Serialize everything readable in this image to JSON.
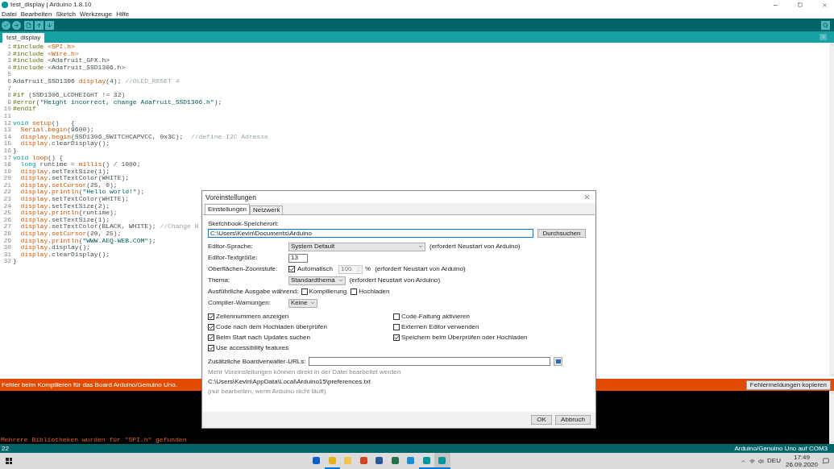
{
  "window": {
    "title": "test_display | Arduino 1.8.10"
  },
  "menu": [
    "Datei",
    "Bearbeiten",
    "Sketch",
    "Werkzeuge",
    "Hilfe"
  ],
  "tabs": [
    {
      "label": "test_display",
      "selected": true
    }
  ],
  "code": [
    {
      "n": "1",
      "tokens": [
        {
          "kind": "dir",
          "t": "#include "
        },
        {
          "kind": "fn",
          "t": "<SPI.h>"
        }
      ]
    },
    {
      "n": "2",
      "tokens": [
        {
          "kind": "dir",
          "t": "#include "
        },
        {
          "kind": "fn",
          "t": "<Wire.h>"
        }
      ]
    },
    {
      "n": "3",
      "tokens": [
        {
          "kind": "dir",
          "t": "#include"
        },
        {
          "kind": "p",
          "t": " <Adafruit_GFX.h>"
        }
      ]
    },
    {
      "n": "4",
      "tokens": [
        {
          "kind": "dir",
          "t": "#include"
        },
        {
          "kind": "p",
          "t": " <Adafruit_SSD1306.h>"
        }
      ]
    },
    {
      "n": "5"
    },
    {
      "n": "6",
      "tokens": [
        {
          "kind": "p",
          "t": "Adafruit_SSD1306 "
        },
        {
          "kind": "fn",
          "t": "display"
        },
        {
          "kind": "p",
          "t": "(4); "
        },
        {
          "kind": "cm",
          "t": "//OLED_RESET 4"
        }
      ]
    },
    {
      "n": "7"
    },
    {
      "n": "8",
      "tokens": [
        {
          "kind": "dir",
          "t": "#if"
        },
        {
          "kind": "p",
          "t": " (SSD1306_LCDHEIGHT != 32)"
        }
      ]
    },
    {
      "n": "9",
      "tokens": [
        {
          "kind": "dir",
          "t": "#error"
        },
        {
          "kind": "p",
          "t": "("
        },
        {
          "kind": "str",
          "t": "\"Height incorrect, change Adafruit_SSD1306.h\""
        },
        {
          "kind": "p",
          "t": ");"
        }
      ]
    },
    {
      "n": "10",
      "tokens": [
        {
          "kind": "dir",
          "t": "#endif"
        }
      ]
    },
    {
      "n": "11"
    },
    {
      "n": "12",
      "tokens": [
        {
          "kind": "kw",
          "t": "void "
        },
        {
          "kind": "fn",
          "t": "setup"
        },
        {
          "kind": "p",
          "t": "()   {"
        }
      ]
    },
    {
      "n": "13",
      "tokens": [
        {
          "kind": "fn",
          "t": "  Serial"
        },
        {
          "kind": "p",
          "t": "."
        },
        {
          "kind": "fn",
          "t": "begin"
        },
        {
          "kind": "p",
          "t": "(9600);"
        }
      ]
    },
    {
      "n": "14",
      "tokens": [
        {
          "kind": "fn",
          "t": "  display"
        },
        {
          "kind": "p",
          "t": "."
        },
        {
          "kind": "fn",
          "t": "begin"
        },
        {
          "kind": "p",
          "t": "(SSD1306_SWITCHCAPVCC, 0x3C);  "
        },
        {
          "kind": "cm",
          "t": "//define I2C Adresse"
        }
      ]
    },
    {
      "n": "15",
      "tokens": [
        {
          "kind": "fn",
          "t": "  display"
        },
        {
          "kind": "p",
          "t": ".clearDisplay();"
        }
      ]
    },
    {
      "n": "16",
      "tokens": [
        {
          "kind": "p",
          "t": "}"
        }
      ]
    },
    {
      "n": "17",
      "tokens": [
        {
          "kind": "kw",
          "t": "void "
        },
        {
          "kind": "fn",
          "t": "loop"
        },
        {
          "kind": "p",
          "t": "() {"
        }
      ]
    },
    {
      "n": "18",
      "tokens": [
        {
          "kind": "kw",
          "t": "  long"
        },
        {
          "kind": "p",
          "t": " runtime = "
        },
        {
          "kind": "fn",
          "t": "millis"
        },
        {
          "kind": "p",
          "t": "() / 1000;"
        }
      ]
    },
    {
      "n": "19",
      "tokens": [
        {
          "kind": "fn",
          "t": "  display"
        },
        {
          "kind": "p",
          "t": ".setTextSize(1);"
        }
      ]
    },
    {
      "n": "20",
      "tokens": [
        {
          "kind": "fn",
          "t": "  display"
        },
        {
          "kind": "p",
          "t": ".setTextColor(WHITE);"
        }
      ]
    },
    {
      "n": "21",
      "tokens": [
        {
          "kind": "fn",
          "t": "  display"
        },
        {
          "kind": "p",
          "t": "."
        },
        {
          "kind": "fn",
          "t": "setCursor"
        },
        {
          "kind": "p",
          "t": "(25, 0);"
        }
      ]
    },
    {
      "n": "22",
      "tokens": [
        {
          "kind": "fn",
          "t": "  display"
        },
        {
          "kind": "p",
          "t": "."
        },
        {
          "kind": "fn",
          "t": "println"
        },
        {
          "kind": "p",
          "t": "("
        },
        {
          "kind": "str",
          "t": "\"Hello world!\""
        },
        {
          "kind": "p",
          "t": ");"
        }
      ]
    },
    {
      "n": "23",
      "tokens": [
        {
          "kind": "fn",
          "t": "  display"
        },
        {
          "kind": "p",
          "t": ".setTextColor(WHITE);"
        }
      ]
    },
    {
      "n": "24",
      "tokens": [
        {
          "kind": "fn",
          "t": "  display"
        },
        {
          "kind": "p",
          "t": ".setTextSize(2);"
        }
      ]
    },
    {
      "n": "25",
      "tokens": [
        {
          "kind": "fn",
          "t": "  display"
        },
        {
          "kind": "p",
          "t": "."
        },
        {
          "kind": "fn",
          "t": "println"
        },
        {
          "kind": "p",
          "t": "(runtime);"
        }
      ]
    },
    {
      "n": "26",
      "tokens": [
        {
          "kind": "fn",
          "t": "  display"
        },
        {
          "kind": "p",
          "t": ".setTextSize(1);"
        }
      ]
    },
    {
      "n": "27",
      "tokens": [
        {
          "kind": "fn",
          "t": "  display"
        },
        {
          "kind": "p",
          "t": ".setTextColor(BLACK, WHITE); "
        },
        {
          "kind": "cm",
          "t": "//Change B"
        }
      ]
    },
    {
      "n": "28",
      "tokens": [
        {
          "kind": "fn",
          "t": "  display"
        },
        {
          "kind": "p",
          "t": "."
        },
        {
          "kind": "fn",
          "t": "setCursor"
        },
        {
          "kind": "p",
          "t": "(20, 25);"
        }
      ]
    },
    {
      "n": "29",
      "tokens": [
        {
          "kind": "fn",
          "t": "  display"
        },
        {
          "kind": "p",
          "t": "."
        },
        {
          "kind": "fn",
          "t": "println"
        },
        {
          "kind": "p",
          "t": "("
        },
        {
          "kind": "str",
          "t": "\"WWW.AEQ-WEB.COM\""
        },
        {
          "kind": "p",
          "t": ");"
        }
      ]
    },
    {
      "n": "30",
      "tokens": [
        {
          "kind": "fn",
          "t": "  display"
        },
        {
          "kind": "p",
          "t": ".display();"
        }
      ]
    },
    {
      "n": "31",
      "tokens": [
        {
          "kind": "fn",
          "t": "  display"
        },
        {
          "kind": "p",
          "t": ".clearDisplay();"
        }
      ]
    },
    {
      "n": "32",
      "tokens": [
        {
          "kind": "p",
          "t": "}"
        }
      ]
    }
  ],
  "dialog": {
    "title": "Voreinstellungen",
    "tabs": [
      {
        "label": "Einstellungen",
        "selected": true
      },
      {
        "label": "Netzwerk",
        "selected": false
      }
    ],
    "sketchbook_label": "Sketchbook-Speicherort:",
    "sketchbook_path": "C:\\Users\\Kevin\\Documents\\Arduino",
    "browse_button": "Durchsuchen",
    "settings": [
      {
        "kind": "wide-select",
        "label": "Editor-Sprache:",
        "value": "System Default",
        "note": "(erfordert Neustart von Arduino)"
      },
      {
        "kind": "text",
        "label": "Editor-Textgröße:",
        "value": "13"
      },
      {
        "kind": "zoom",
        "label": "Oberflächen-Zoomstufe:",
        "check": {
          "label": "Automatisch",
          "checked": true
        },
        "value": "100",
        "disabled": true,
        "unit": "%",
        "note": "(erfordert Neustart von Arduino)"
      },
      {
        "kind": "select",
        "label": "Thema:",
        "value": "Standardthema",
        "note": "(erfordert Neustart von Arduino)"
      },
      {
        "kind": "checks",
        "label": "Ausführliche Ausgabe während:",
        "options": [
          {
            "label": "Kompilierung",
            "checked": false
          },
          {
            "label": "Hochladen",
            "checked": false
          }
        ]
      },
      {
        "kind": "select",
        "label": "Compiler-Warnungen:",
        "value": "Keine"
      }
    ],
    "options": [
      {
        "label": "Zeilennummern anzeigen",
        "checked": true
      },
      {
        "label": "Code-Faltung aktivieren",
        "checked": false
      },
      {
        "label": "Code nach dem Hochladen überprüfen",
        "checked": true
      },
      {
        "label": "Externen Editor verwenden",
        "checked": false
      },
      {
        "label": "Beim Start nach Updates suchen",
        "checked": true
      },
      {
        "label": "Speichern beim Überprüfen oder Hochladen",
        "checked": true
      },
      {
        "label": "Use accessibility features",
        "checked": true
      }
    ],
    "urls_label": "Zusätzliche Boardverwalter-URLs:",
    "hint": "Mehr Voreinstellungen können direkt in der Datei bearbeitet werden",
    "prefs_path": "C:\\Users\\Kevin\\AppData\\Local\\Arduino15\\preferences.txt",
    "prefs_note": "(nur bearbeiten, wenn Arduino nicht läuft)",
    "buttons": [
      "OK",
      "Abbruch"
    ]
  },
  "error_bar": {
    "message": "Fehler beim Kompilieren für das Board Arduino/Genuino Uno.",
    "button": "Fehlermeldungen kopieren"
  },
  "console": [
    "Mehrere Bibliotheken wurden für \"SPI.h\" gefunden"
  ],
  "status_bar": {
    "line": "22",
    "board": "Arduino/Genuino Uno auf COM3"
  },
  "taskbar": {
    "apps": [
      {
        "color": "#0a64c8",
        "running": false,
        "selected": false
      },
      {
        "color": "#e8b21c",
        "running": true,
        "selected": false
      },
      {
        "color": "#f2c14e",
        "running": false,
        "selected": false
      },
      {
        "color": "#d04423",
        "running": false,
        "selected": false
      },
      {
        "color": "#2b579a",
        "running": false,
        "selected": false
      },
      {
        "color": "#217346",
        "running": false,
        "selected": false
      },
      {
        "color": "#1b8fd6",
        "running": false,
        "selected": false
      },
      {
        "color": "#00979c",
        "running": true,
        "selected": false
      },
      {
        "color": "#00979c",
        "running": true,
        "selected": true
      }
    ],
    "language": "DEU",
    "time": "17:49",
    "date": "26.09.2020"
  }
}
